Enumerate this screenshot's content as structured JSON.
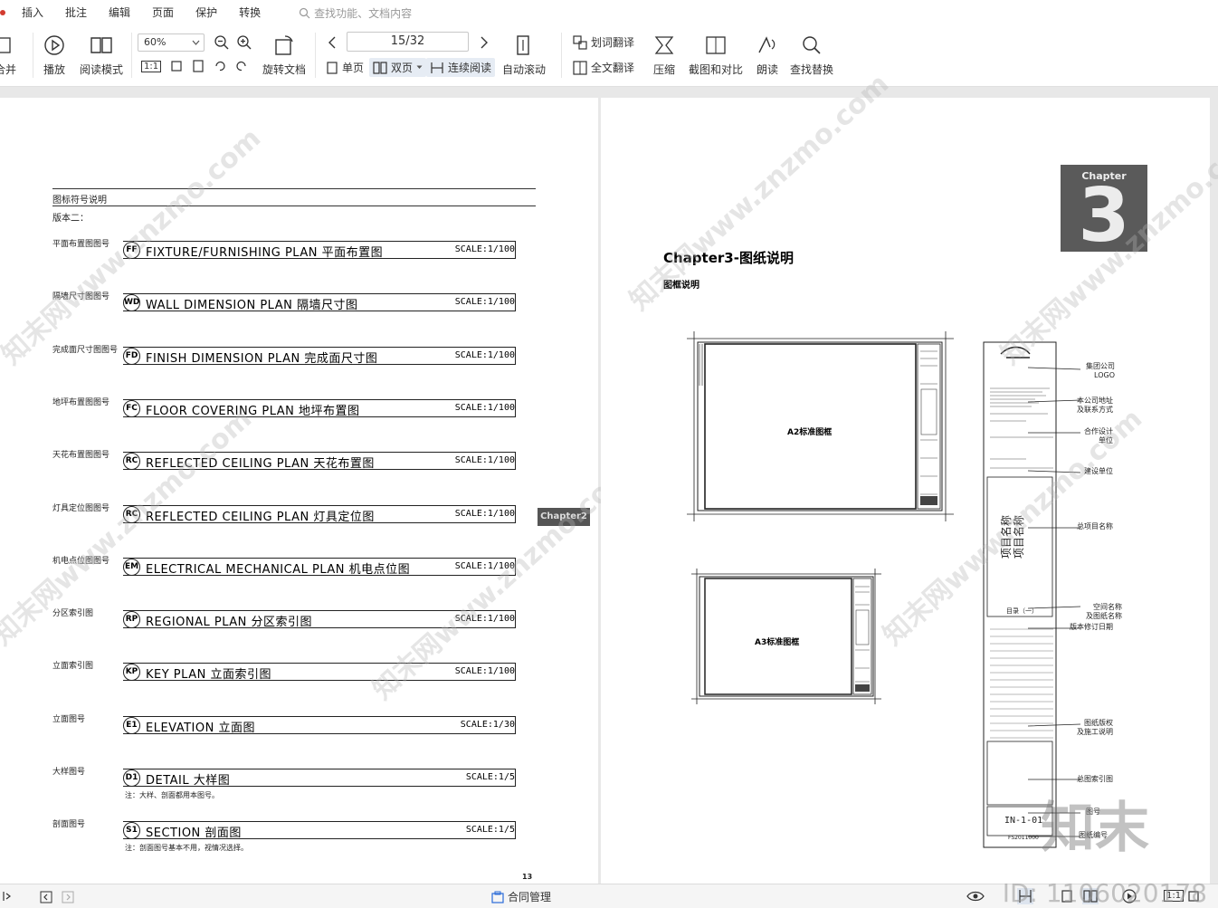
{
  "menu": {
    "items": [
      "插入",
      "批注",
      "编辑",
      "页面",
      "保护",
      "转换"
    ],
    "search_placeholder": "查找功能、文档内容"
  },
  "toolbar": {
    "merge_label": "合并",
    "play_label": "播放",
    "read_mode_label": "阅读模式",
    "zoom_value": "60%",
    "rotate_label": "旋转文档",
    "page_indicator": "15/32",
    "single_page_label": "单页",
    "double_page_label": "双页",
    "continuous_label": "连续阅读",
    "auto_scroll_label": "自动滚动",
    "word_translate_label": "划词翻译",
    "full_translate_label": "全文翻译",
    "compress_label": "压缩",
    "screenshot_label": "截图和对比",
    "read_aloud_label": "朗读",
    "find_replace_label": "查找替换",
    "actual_size_label": "1:1"
  },
  "left_page": {
    "heading": "图标符号说明",
    "version": "版本二：",
    "page_number": "13",
    "chapter_tag": "Chapter2",
    "symbols": [
      {
        "label": "平面布置图图号",
        "code": "FF",
        "title": "FIXTURE/FURNISHING PLAN  平面布置图",
        "scale": "SCALE:1/100"
      },
      {
        "label": "隔墙尺寸图图号",
        "code": "WD",
        "title": "WALL DIMENSION PLAN  隔墙尺寸图",
        "scale": "SCALE:1/100"
      },
      {
        "label": "完成面尺寸图图号",
        "code": "FD",
        "title": "FINISH DIMENSION PLAN  完成面尺寸图",
        "scale": "SCALE:1/100"
      },
      {
        "label": "地坪布置图图号",
        "code": "FC",
        "title": "FLOOR COVERING PLAN  地坪布置图",
        "scale": "SCALE:1/100"
      },
      {
        "label": "天花布置图图号",
        "code": "RC",
        "title": "REFLECTED CEILING PLAN   天花布置图",
        "scale": "SCALE:1/100"
      },
      {
        "label": "灯具定位图图号",
        "code": "RC",
        "title": "REFLECTED CEILING PLAN   灯具定位图",
        "scale": "SCALE:1/100"
      },
      {
        "label": "机电点位图图号",
        "code": "EM",
        "title": "ELECTRICAL MECHANICAL PLAN  机电点位图",
        "scale": "SCALE:1/100"
      },
      {
        "label": "分区索引图",
        "code": "RP",
        "title": "REGIONAL PLAN   分区索引图",
        "scale": "SCALE:1/100"
      },
      {
        "label": "立面索引图",
        "code": "KP",
        "title": "KEY PLAN   立面索引图",
        "scale": "SCALE:1/100"
      },
      {
        "label": "立面图号",
        "code": "E1",
        "title": "ELEVATION   立面图",
        "scale": "SCALE:1/30"
      },
      {
        "label": "大样图号",
        "code": "D1",
        "title": "DETAIL   大样图",
        "scale": "SCALE:1/5",
        "note": "注：大样、剖面都用本图号。"
      },
      {
        "label": "剖面图号",
        "code": "S1",
        "title": "SECTION   剖面图",
        "scale": "SCALE:1/5",
        "note": "注：剖面图号基本不用，视情况选择。"
      }
    ]
  },
  "right_page": {
    "title": "Chapter3-图纸说明",
    "subtitle": "图框说明",
    "badge_small": "Chapter",
    "badge_big": "3",
    "a2_label": "A2标准图框",
    "a3_label": "A3标准图框",
    "strip_code": "IN-1-01",
    "strip_number": "FS2011000",
    "strip_target": "目录（一）",
    "callouts": [
      "集团公司\nLOGO",
      "本公司地址\n及联系方式",
      "合作设计\n单位",
      "建设单位",
      "总项目名称",
      "空间名称\n及图纸名称",
      "版本修订日期",
      "图纸版权\n及施工说明",
      "总图索引图",
      "图号",
      "图纸编号"
    ]
  },
  "statusbar": {
    "contract_label": "合同管理",
    "actual_size": "1:1"
  },
  "overlay": {
    "watermark_text": "知末网www.znzmo.com",
    "brand_text": "知末",
    "id_text": "ID: 1106020178"
  }
}
